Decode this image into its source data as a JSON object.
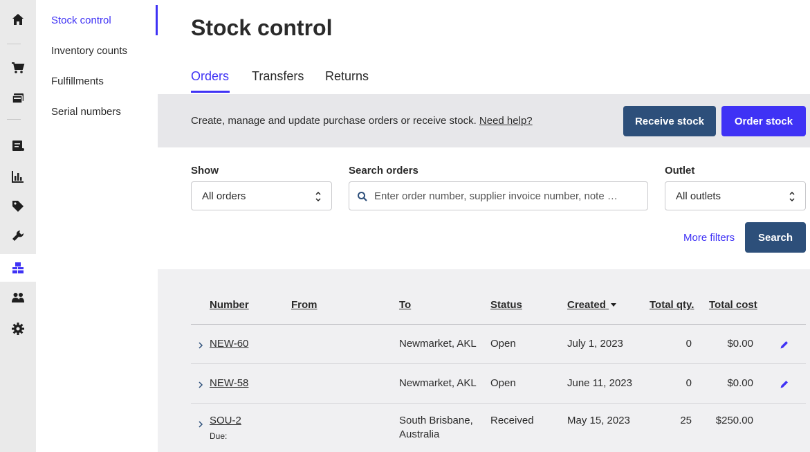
{
  "rail": {
    "items": [
      {
        "icon": "home-icon"
      },
      {
        "icon": "cart-icon"
      },
      {
        "icon": "register-icon"
      },
      {
        "icon": "sales-ledger-icon"
      },
      {
        "icon": "reporting-icon"
      },
      {
        "icon": "tag-icon"
      },
      {
        "icon": "wrench-icon"
      },
      {
        "icon": "inventory-icon",
        "active": true
      },
      {
        "icon": "customers-icon"
      },
      {
        "icon": "gear-icon"
      }
    ],
    "accent": "#3f32f5"
  },
  "subnav": {
    "items": [
      {
        "label": "Stock control",
        "active": true
      },
      {
        "label": "Inventory counts"
      },
      {
        "label": "Fulfillments"
      },
      {
        "label": "Serial numbers"
      }
    ]
  },
  "page": {
    "title": "Stock control",
    "tabs": [
      {
        "label": "Orders",
        "active": true
      },
      {
        "label": "Transfers"
      },
      {
        "label": "Returns"
      }
    ]
  },
  "banner": {
    "text": "Create, manage and update purchase orders or receive stock.",
    "help_link": "Need help?",
    "receive_label": "Receive stock",
    "order_label": "Order stock"
  },
  "filters": {
    "show_label": "Show",
    "show_value": "All orders",
    "search_label": "Search orders",
    "search_placeholder": "Enter order number, supplier invoice number, note or pr…",
    "outlet_label": "Outlet",
    "outlet_value": "All outlets",
    "more_filters": "More filters",
    "search_button": "Search"
  },
  "table": {
    "headers": {
      "number": "Number",
      "from": "From",
      "to": "To",
      "status": "Status",
      "created": "Created",
      "total_qty": "Total qty.",
      "total_cost": "Total cost"
    },
    "rows": [
      {
        "number": "NEW-60",
        "from": "",
        "to": "Newmarket, AKL",
        "to2": "",
        "status": "Open",
        "created": "July 1, 2023",
        "qty": "0",
        "cost": "$0.00",
        "due": "",
        "editable": true
      },
      {
        "number": "NEW-58",
        "from": "",
        "to": "Newmarket, AKL",
        "to2": "",
        "status": "Open",
        "created": "June 11, 2023",
        "qty": "0",
        "cost": "$0.00",
        "due": "",
        "editable": true
      },
      {
        "number": "SOU-2",
        "from": "",
        "to": "South Brisbane,",
        "to2": "Australia",
        "status": "Received",
        "created": "May 15, 2023",
        "qty": "25",
        "cost": "$250.00",
        "due": "Due:",
        "editable": false
      }
    ]
  }
}
